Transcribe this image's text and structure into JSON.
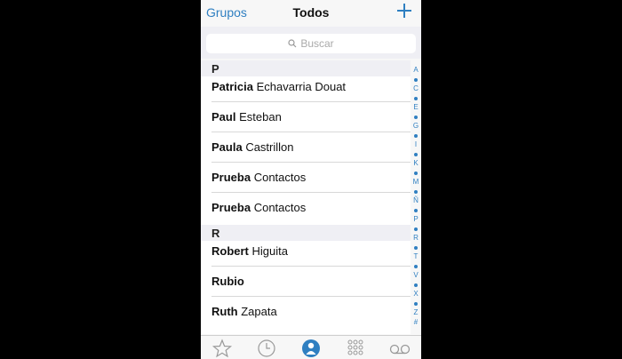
{
  "navbar": {
    "left_label": "Grupos",
    "title": "Todos",
    "add_icon": "plus-icon"
  },
  "search": {
    "placeholder": "Buscar"
  },
  "sections": [
    {
      "letter": "P",
      "contacts": [
        {
          "first": "Patricia",
          "last": "Echavarria Douat"
        },
        {
          "first": "Paul",
          "last": "Esteban"
        },
        {
          "first": "Paula",
          "last": "Castrillon"
        },
        {
          "first": "Prueba",
          "last": "Contactos"
        },
        {
          "first": "Prueba",
          "last": "Contactos"
        }
      ]
    },
    {
      "letter": "R",
      "contacts": [
        {
          "first": "Robert",
          "last": " Higuita"
        },
        {
          "first": "Rubio",
          "last": ""
        },
        {
          "first": "Ruth",
          "last": "Zapata"
        }
      ]
    }
  ],
  "index": [
    "A",
    "•",
    "C",
    "•",
    "E",
    "•",
    "G",
    "•",
    "I",
    "•",
    "K",
    "•",
    "M",
    "•",
    "Ñ",
    "•",
    "P",
    "•",
    "R",
    "•",
    "T",
    "•",
    "V",
    "•",
    "X",
    "•",
    "Z",
    "#"
  ],
  "tabs": [
    "star-icon",
    "clock-icon",
    "contacts-icon",
    "keypad-icon",
    "voicemail-icon"
  ],
  "colors": {
    "accent": "#2f7fc1",
    "background": "#000000",
    "section": "#efeff4"
  }
}
